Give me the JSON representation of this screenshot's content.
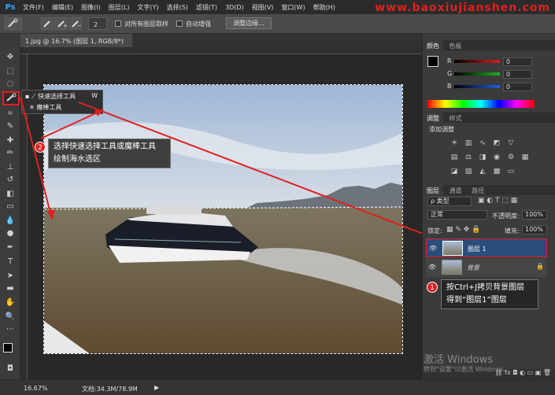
{
  "app": {
    "logo": "Ps",
    "watermark_site": "www.baoxiujianshen.com"
  },
  "menu": [
    "文件(F)",
    "编辑(E)",
    "图像(I)",
    "图层(L)",
    "文字(Y)",
    "选择(S)",
    "滤镜(T)",
    "3D(D)",
    "视图(V)",
    "窗口(W)",
    "帮助(H)"
  ],
  "options": {
    "size_value": "2",
    "sample_all_layers": "对所有图层取样",
    "auto_enhance": "自动增强",
    "refine_edge": "调整边缘..."
  },
  "document": {
    "tab_title": "1.jpg @ 16.7% (图层 1, RGB/8*) *",
    "close": "×"
  },
  "flyout": [
    {
      "label": "快速选择工具",
      "key": "W"
    },
    {
      "label": "魔棒工具",
      "key": "W"
    }
  ],
  "annotations": {
    "step2_badge": "2",
    "step2_line1": "选择快速选择工具或魔棒工具",
    "step2_line2": "绘制海水选区",
    "step1_badge": "1",
    "step1_line1": "按Ctrl+J拷贝背景图层",
    "step1_line2": "得到“图层1”图层"
  },
  "color_panel": {
    "tabs": [
      "颜色",
      "色板"
    ],
    "channels": [
      {
        "label": "R",
        "value": "0",
        "color": "#d62020"
      },
      {
        "label": "G",
        "value": "0",
        "color": "#20b020"
      },
      {
        "label": "B",
        "value": "0",
        "color": "#2060e0"
      }
    ]
  },
  "adjust_panel": {
    "tabs": [
      "调整",
      "样式"
    ],
    "title": "添加调整"
  },
  "layers_panel": {
    "tabs": [
      "图层",
      "通道",
      "路径"
    ],
    "filter_kind": "类型",
    "blend_mode": "正常",
    "opacity_label": "不透明度:",
    "opacity_value": "100%",
    "lock_label": "锁定:",
    "fill_label": "填充:",
    "fill_value": "100%",
    "layers": [
      {
        "name": "图层 1",
        "selected": true
      },
      {
        "name": "背景",
        "selected": false
      }
    ]
  },
  "watermark": {
    "line1": "激活 Windows",
    "line2": "转到\"设置\"以激活 Windows。"
  },
  "status": {
    "zoom": "16.67%",
    "doc_info": "文档:34.3M/78.9M"
  },
  "colors": {
    "accent_red": "#e02020",
    "selection_blue": "#2a4d7a"
  }
}
